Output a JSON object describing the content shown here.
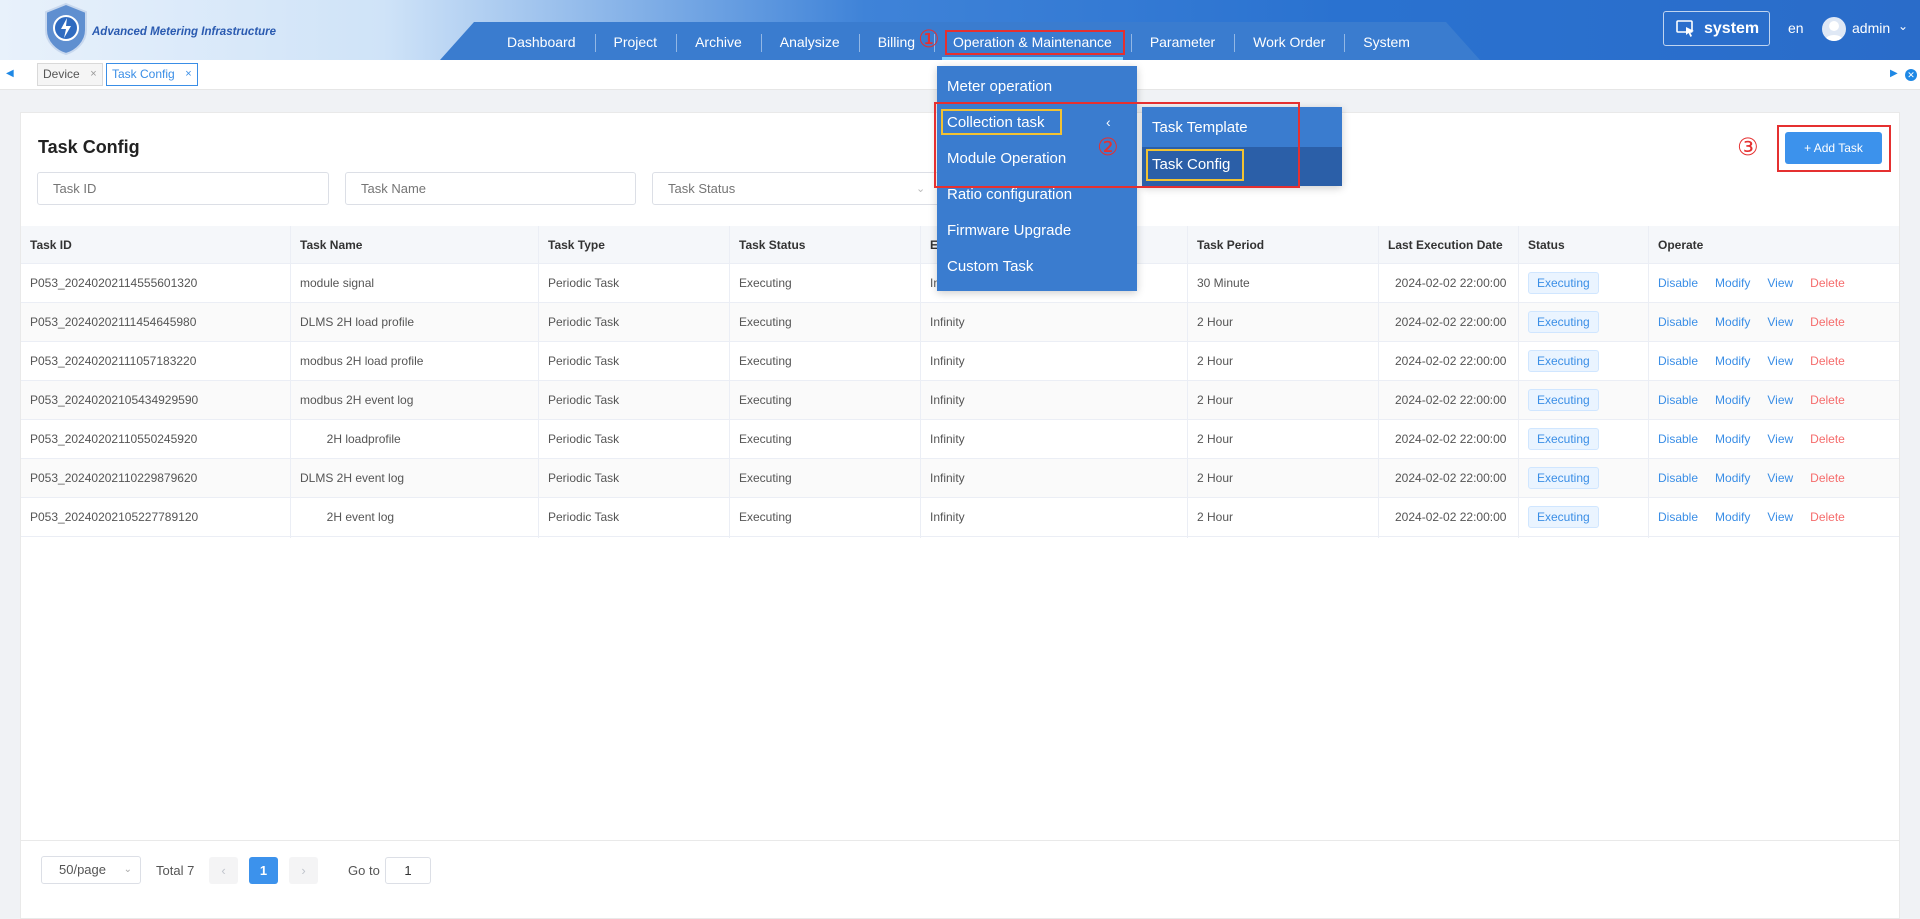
{
  "header": {
    "app_title": "Advanced Metering Infrastructure",
    "nav": [
      "Dashboard",
      "Project",
      "Archive",
      "Analysize",
      "Billing",
      "Operation & Maintenance",
      "Parameter",
      "Work Order",
      "System"
    ],
    "system_label": "system",
    "lang": "en",
    "user": "admin"
  },
  "tabs": [
    {
      "label": "Device"
    },
    {
      "label": "Task Config"
    }
  ],
  "page": {
    "title": "Task Config",
    "task_id_placeholder": "Task ID",
    "task_name_placeholder": "Task Name",
    "task_status_placeholder": "Task Status",
    "add_task_label": "+ Add Task"
  },
  "table": {
    "headers": [
      "Task ID",
      "Task Name",
      "Task Type",
      "Task Status",
      "E",
      "Task Period",
      "Last Execution Date",
      "Status",
      "Operate"
    ],
    "ops": [
      "Disable",
      "Modify",
      "View",
      "Delete"
    ],
    "rows": [
      [
        "P053_20240202114555601320",
        "module signal",
        "Periodic Task",
        "Executing",
        "In",
        "30 Minute",
        "2024-02-02 22:00:00",
        "Executing"
      ],
      [
        "P053_20240202111454645980",
        "DLMS 2H load profile",
        "Periodic Task",
        "Executing",
        "Infinity",
        "2 Hour",
        "2024-02-02 22:00:00",
        "Executing"
      ],
      [
        "P053_20240202111057183220",
        "modbus 2H load profile",
        "Periodic Task",
        "Executing",
        "Infinity",
        "2 Hour",
        "2024-02-02 22:00:00",
        "Executing"
      ],
      [
        "P053_20240202105434929590",
        "modbus 2H event log",
        "Periodic Task",
        "Executing",
        "Infinity",
        "2 Hour",
        "2024-02-02 22:00:00",
        "Executing"
      ],
      [
        "P053_20240202110550245920",
        "        2H loadprofile",
        "Periodic Task",
        "Executing",
        "Infinity",
        "2 Hour",
        "2024-02-02 22:00:00",
        "Executing"
      ],
      [
        "P053_20240202110229879620",
        "DLMS 2H event log",
        "Periodic Task",
        "Executing",
        "Infinity",
        "2 Hour",
        "2024-02-02 22:00:00",
        "Executing"
      ],
      [
        "P053_20240202105227789120",
        "        2H event log",
        "Periodic Task",
        "Executing",
        "Infinity",
        "2 Hour",
        "2024-02-02 22:00:00",
        "Executing"
      ]
    ]
  },
  "pagination": {
    "page_size": "50/page",
    "total": "Total 7",
    "current_page": "1",
    "goto_label": "Go to",
    "goto_value": "1"
  },
  "dropdown": {
    "level1": [
      "Meter operation",
      "Collection task",
      "Module Operation",
      "Ratio configuration",
      "Firmware Upgrade",
      "Custom Task"
    ],
    "level2": [
      "Task Template",
      "Task Config"
    ]
  },
  "annotations": [
    "①",
    "②",
    "③"
  ],
  "colors": {
    "primary": "#3c92ec",
    "danger": "#f56c6c",
    "nav": "#3a7ccf",
    "annotation": "#e53030",
    "highlight": "#f1c232"
  }
}
